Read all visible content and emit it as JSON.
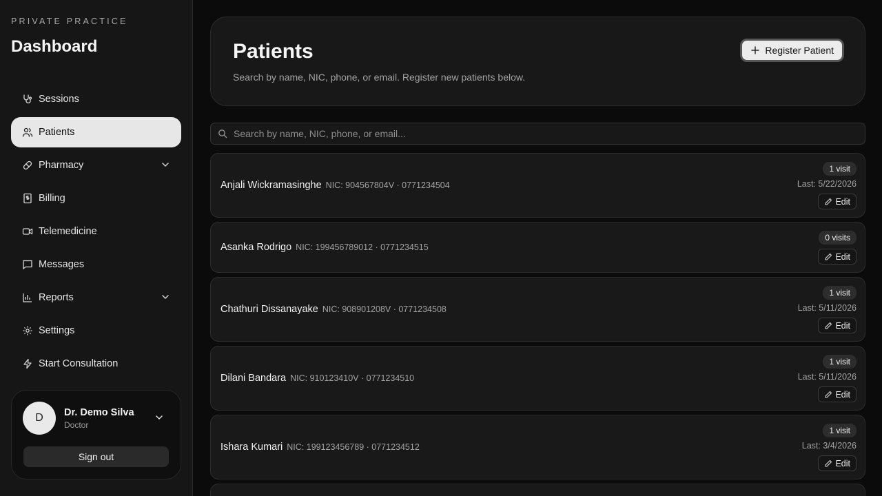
{
  "sidebar": {
    "kicker": "PRIVATE PRACTICE",
    "title": "Dashboard",
    "items": [
      {
        "label": "Sessions",
        "icon": "stethoscope-icon"
      },
      {
        "label": "Patients",
        "icon": "users-icon"
      },
      {
        "label": "Pharmacy",
        "icon": "pill-icon"
      },
      {
        "label": "Billing",
        "icon": "receipt-icon"
      },
      {
        "label": "Telemedicine",
        "icon": "video-icon"
      },
      {
        "label": "Messages",
        "icon": "message-icon"
      },
      {
        "label": "Reports",
        "icon": "bar-chart-icon"
      },
      {
        "label": "Settings",
        "icon": "gear-icon"
      },
      {
        "label": "Start Consultation",
        "icon": "lightning-icon"
      }
    ],
    "user": {
      "initial": "D",
      "name": "Dr. Demo Silva",
      "role": "Doctor",
      "sign_out": "Sign out"
    }
  },
  "header": {
    "title": "Patients",
    "subtitle": "Search by name, NIC, phone, or email. Register new patients below.",
    "register_label": "Register Patient"
  },
  "search": {
    "placeholder": "Search by name, NIC, phone, or email..."
  },
  "patients": [
    {
      "name": "Anjali Wickramasinghe",
      "meta": "NIC: 904567804V · 0771234504",
      "visits": "1 visit",
      "last": "Last: 5/22/2026",
      "edit": "Edit"
    },
    {
      "name": "Asanka Rodrigo",
      "meta": "NIC: 199456789012 · 0771234515",
      "visits": "0 visits",
      "last": "",
      "edit": "Edit"
    },
    {
      "name": "Chathuri Dissanayake",
      "meta": "NIC: 908901208V · 0771234508",
      "visits": "1 visit",
      "last": "Last: 5/11/2026",
      "edit": "Edit"
    },
    {
      "name": "Dilani Bandara",
      "meta": "NIC: 910123410V · 0771234510",
      "visits": "1 visit",
      "last": "Last: 5/11/2026",
      "edit": "Edit"
    },
    {
      "name": "Ishara Kumari",
      "meta": "NIC: 199123456789 · 0771234512",
      "visits": "1 visit",
      "last": "Last: 3/4/2026",
      "edit": "Edit"
    }
  ]
}
